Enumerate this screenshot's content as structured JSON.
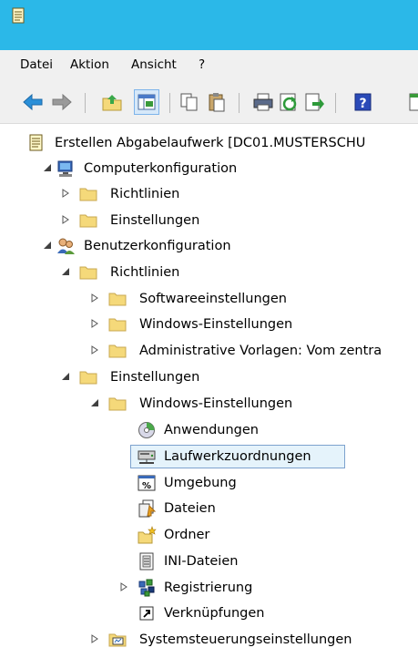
{
  "menu": {
    "file": "Datei",
    "action": "Aktion",
    "view": "Ansicht",
    "help": "?"
  },
  "toolbar": {
    "buttons": [
      "back-icon",
      "forward-icon",
      "up-folder-icon",
      "show-tree-icon",
      "copy-icon",
      "paste-icon",
      "print-icon",
      "refresh-icon",
      "export-icon",
      "help-icon"
    ]
  },
  "tree": {
    "root": "Erstellen Abgabelaufwerk [DC01.MUSTERSCHU",
    "computer_config": "Computerkonfiguration",
    "cc_policies": "Richtlinien",
    "cc_preferences": "Einstellungen",
    "user_config": "Benutzerkonfiguration",
    "uc_policies": "Richtlinien",
    "software_settings": "Softwareeinstellungen",
    "windows_settings_policy": "Windows-Einstellungen",
    "admin_templates": "Administrative Vorlagen: Vom zentra",
    "uc_preferences": "Einstellungen",
    "windows_settings_pref": "Windows-Einstellungen",
    "applications": "Anwendungen",
    "drive_maps": "Laufwerkzuordnungen",
    "environment": "Umgebung",
    "files": "Dateien",
    "folders": "Ordner",
    "ini_files": "INI-Dateien",
    "registry": "Registrierung",
    "shortcuts": "Verknüpfungen",
    "control_panel": "Systemsteuerungseinstellungen"
  },
  "colors": {
    "titlebar": "#2bb8e8",
    "selection_bg": "#e5f3fb",
    "selection_border": "#7da2ce",
    "folder": "#f5d97a"
  }
}
